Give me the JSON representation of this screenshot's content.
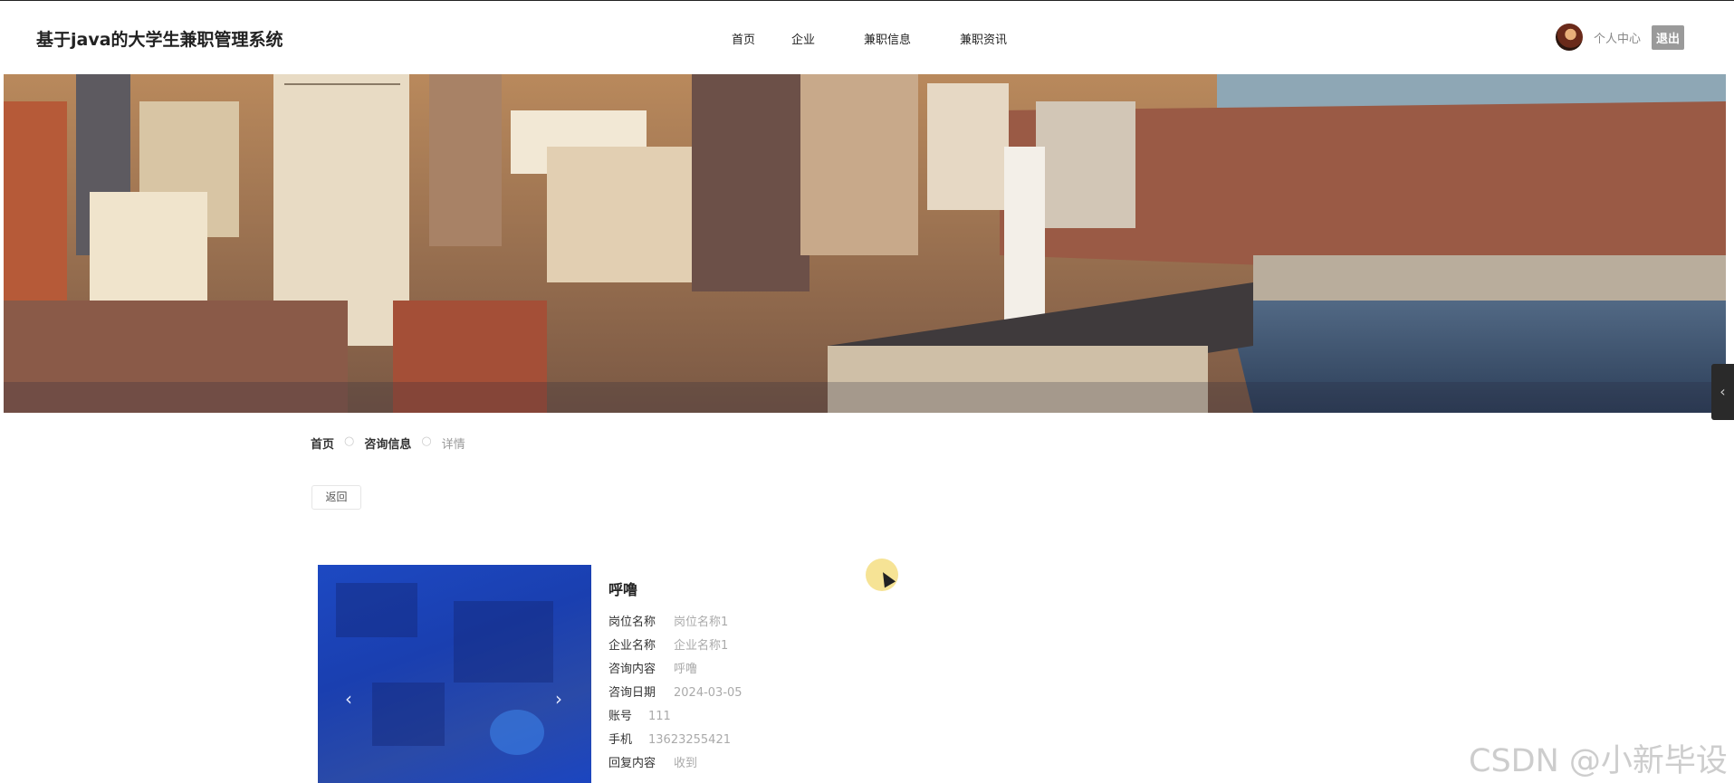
{
  "header": {
    "site_title": "基于java的大学生兼职管理系统",
    "nav": [
      "首页",
      "企业",
      "兼职信息",
      "兼职资讯"
    ],
    "user_center": "个人中心",
    "logout": "退出"
  },
  "breadcrumb": {
    "items": [
      "首页",
      "咨询信息"
    ],
    "separator": "○",
    "current": "详情"
  },
  "back_button": "返回",
  "carousel": {
    "prev": "‹",
    "next": "›"
  },
  "detail": {
    "title": "呼噜",
    "fields": [
      {
        "label": "岗位名称",
        "value": "岗位名称1"
      },
      {
        "label": "企业名称",
        "value": "企业名称1"
      },
      {
        "label": "咨询内容",
        "value": "呼噜"
      },
      {
        "label": "咨询日期",
        "value": "2024-03-05"
      },
      {
        "label": "账号",
        "value": "111"
      },
      {
        "label": "手机",
        "value": "13623255421"
      },
      {
        "label": "回复内容",
        "value": "收到"
      }
    ]
  },
  "side_tab_icon": "‹",
  "watermark": "CSDN @小新毕设",
  "colors": {
    "logout_bg": "#9a9a9a",
    "carousel_blue": "#1d49c2",
    "cursor_highlight": "#f4de82"
  }
}
